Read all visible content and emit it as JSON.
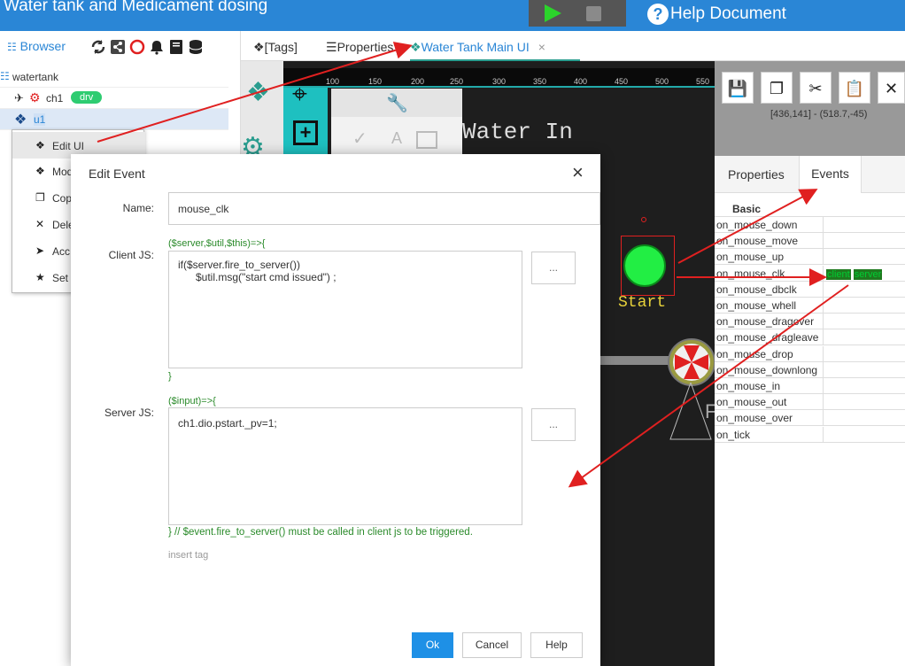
{
  "app": {
    "title": "Water tank and Medicament dosing",
    "help_label": "Help Document",
    "help_glyph": "?"
  },
  "browser": {
    "tab_label": "Browser",
    "tree": [
      {
        "label": "watertank"
      },
      {
        "label": "ch1",
        "badge": "drv"
      },
      {
        "label": "u1"
      }
    ]
  },
  "context_menu": [
    {
      "label": "Edit UI",
      "icon": "puzzle-icon"
    },
    {
      "label": "Mod",
      "icon": "puzzle-icon"
    },
    {
      "label": "Cop",
      "icon": "copy-icon"
    },
    {
      "label": "Dele",
      "icon": "delete-icon"
    },
    {
      "label": "Acc",
      "icon": "send-icon"
    },
    {
      "label": "Set",
      "icon": "star-icon"
    }
  ],
  "editor_tabs": [
    {
      "label": "[Tags]"
    },
    {
      "label": "Properties"
    },
    {
      "label": "Water Tank Main UI",
      "active": true,
      "close": "×"
    }
  ],
  "ruler": [
    "100",
    "150",
    "200",
    "250",
    "300",
    "350",
    "400",
    "450",
    "500",
    "550"
  ],
  "canvas": {
    "water_in": "Water In",
    "start_label": "Start",
    "partial_letter": "F"
  },
  "right_panel": {
    "coord": "[436,141] - (518.7,-45)",
    "tabs": [
      "Properties",
      "Events"
    ],
    "active_tab": "Events",
    "section": "Basic",
    "events": [
      "on_mouse_down",
      "on_mouse_move",
      "on_mouse_up",
      "on_mouse_clk",
      "on_mouse_dbclk",
      "on_mouse_whell",
      "on_mouse_dragover",
      "on_mouse_dragleave",
      "on_mouse_drop",
      "on_mouse_downlong",
      "on_mouse_in",
      "on_mouse_out",
      "on_mouse_over",
      "on_tick"
    ],
    "clk_tags": [
      "client",
      "server"
    ]
  },
  "dialog": {
    "title": "Edit Event",
    "close": "×",
    "name_label": "Name:",
    "name_value": "mouse_clk",
    "client_label": "Client JS:",
    "client_header": "($server,$util,$this)=>{",
    "client_code": "if($server.fire_to_server())\n      $util.msg(\"start cmd issued\") ;",
    "client_footer": "}",
    "server_label": "Server JS:",
    "server_header": "($input)=>{",
    "server_code": "ch1.dio.pstart._pv=1;",
    "server_footer": "} // $event.fire_to_server() must be called in client js to be triggered.",
    "insert_tag": "insert tag",
    "dots": "...",
    "ok": "Ok",
    "cancel": "Cancel",
    "help": "Help"
  },
  "colors": {
    "accent": "#2a86d6",
    "green": "#2a8a2a",
    "arrow": "#e02020",
    "start_button": "#22ee44"
  }
}
